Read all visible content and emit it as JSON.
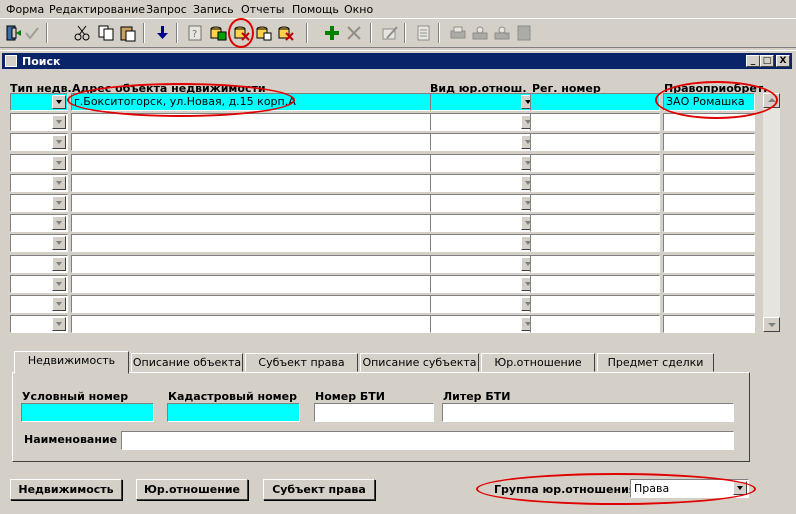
{
  "menu": [
    "Форма",
    "Редактирование",
    "Запрос",
    "Запись",
    "Отчеты",
    "Помощь",
    "Окно"
  ],
  "toolbar": {
    "icons": [
      "exit-door-icon",
      "accept-check-icon",
      "cut-icon",
      "copy-icon",
      "paste-icon",
      "save-down-arrow-icon",
      "query-icon",
      "execute-query-icon",
      "clear-record-icon",
      "insert-record-icon",
      "delete-record-icon",
      "add-plus-icon",
      "remove-x-icon",
      "edit-icon",
      "list-icon",
      "print-icon",
      "print-setup-icon",
      "print-preview-icon",
      "help-icon"
    ]
  },
  "window": {
    "title": "Поиск",
    "controls": [
      "_",
      "□",
      "X"
    ]
  },
  "grid": {
    "headers": [
      "Тип недв.",
      "Адрес объекта недвижимости",
      "Вид юр.отнош.",
      "Рег. номер",
      "Правоприобрет."
    ],
    "rows": [
      {
        "type": "",
        "address": "г.Бокситогорск, ул.Новая, д.15 корп.А",
        "relation": "",
        "reg_number": "",
        "acquirer": "ЗАО Ромашка"
      },
      {
        "type": "",
        "address": "",
        "relation": "",
        "reg_number": "",
        "acquirer": ""
      },
      {
        "type": "",
        "address": "",
        "relation": "",
        "reg_number": "",
        "acquirer": ""
      },
      {
        "type": "",
        "address": "",
        "relation": "",
        "reg_number": "",
        "acquirer": ""
      },
      {
        "type": "",
        "address": "",
        "relation": "",
        "reg_number": "",
        "acquirer": ""
      },
      {
        "type": "",
        "address": "",
        "relation": "",
        "reg_number": "",
        "acquirer": ""
      },
      {
        "type": "",
        "address": "",
        "relation": "",
        "reg_number": "",
        "acquirer": ""
      },
      {
        "type": "",
        "address": "",
        "relation": "",
        "reg_number": "",
        "acquirer": ""
      },
      {
        "type": "",
        "address": "",
        "relation": "",
        "reg_number": "",
        "acquirer": ""
      },
      {
        "type": "",
        "address": "",
        "relation": "",
        "reg_number": "",
        "acquirer": ""
      },
      {
        "type": "",
        "address": "",
        "relation": "",
        "reg_number": "",
        "acquirer": ""
      },
      {
        "type": "",
        "address": "",
        "relation": "",
        "reg_number": "",
        "acquirer": ""
      }
    ]
  },
  "tabs": [
    "Недвижимость",
    "Описание объекта",
    "Субъект права",
    "Описание субъекта",
    "Юр.отношение",
    "Предмет сделки"
  ],
  "active_tab": "Недвижимость",
  "form": {
    "conditional_number": {
      "label": "Условный номер",
      "value": ""
    },
    "cadastral_number": {
      "label": "Кадастровый номер",
      "value": ""
    },
    "bti_number": {
      "label": "Номер БТИ",
      "value": ""
    },
    "bti_letter": {
      "label": "Литер БТИ",
      "value": ""
    },
    "name": {
      "label": "Наименование",
      "value": ""
    }
  },
  "buttons": {
    "realty": "Недвижимость",
    "relation": "Юр.отношение",
    "subject": "Субъект права"
  },
  "relation_group": {
    "label": "Группа юр.отношения",
    "value": "Права"
  },
  "colors": {
    "face": "#d4d0c8",
    "highlight_cell": "#00ffff",
    "title_bar": "#0a246a",
    "annotation_ring": "#e00000"
  }
}
